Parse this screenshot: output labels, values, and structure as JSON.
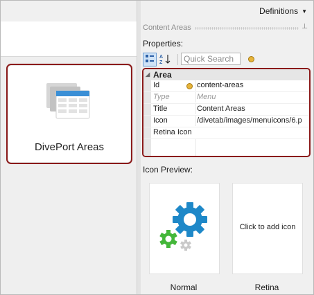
{
  "header": {
    "definitions_label": "Definitions",
    "definitions_caret": "▼"
  },
  "tile": {
    "label": "DivePort Areas"
  },
  "panel": {
    "title": "Content Areas",
    "pin": "⊥",
    "properties_label": "Properties:",
    "toolbar": {
      "categorized": "⠿",
      "alphabetical": "A↓",
      "search_placeholder": "Quick Search"
    },
    "grid": {
      "category": "Area",
      "category_toggle": "◢",
      "rows": [
        {
          "name": "Id",
          "value": "content-areas"
        },
        {
          "name": "Type",
          "value": "Menu"
        },
        {
          "name": "Title",
          "value": "Content Areas"
        },
        {
          "name": "Icon",
          "value": "/divetab/images/menuicons/6.p"
        },
        {
          "name": "Retina Icon",
          "value": ""
        }
      ]
    },
    "icon_preview": {
      "label": "Icon Preview:",
      "retina_placeholder": "Click to add icon",
      "normal_caption": "Normal",
      "retina_caption": "Retina"
    }
  },
  "colors": {
    "selection_border": "#8b1a1a",
    "gear_blue": "#1e88c8",
    "gear_green": "#44b73a",
    "gear_gray": "#c9c9c9",
    "table_blue": "#3a8fd6"
  }
}
